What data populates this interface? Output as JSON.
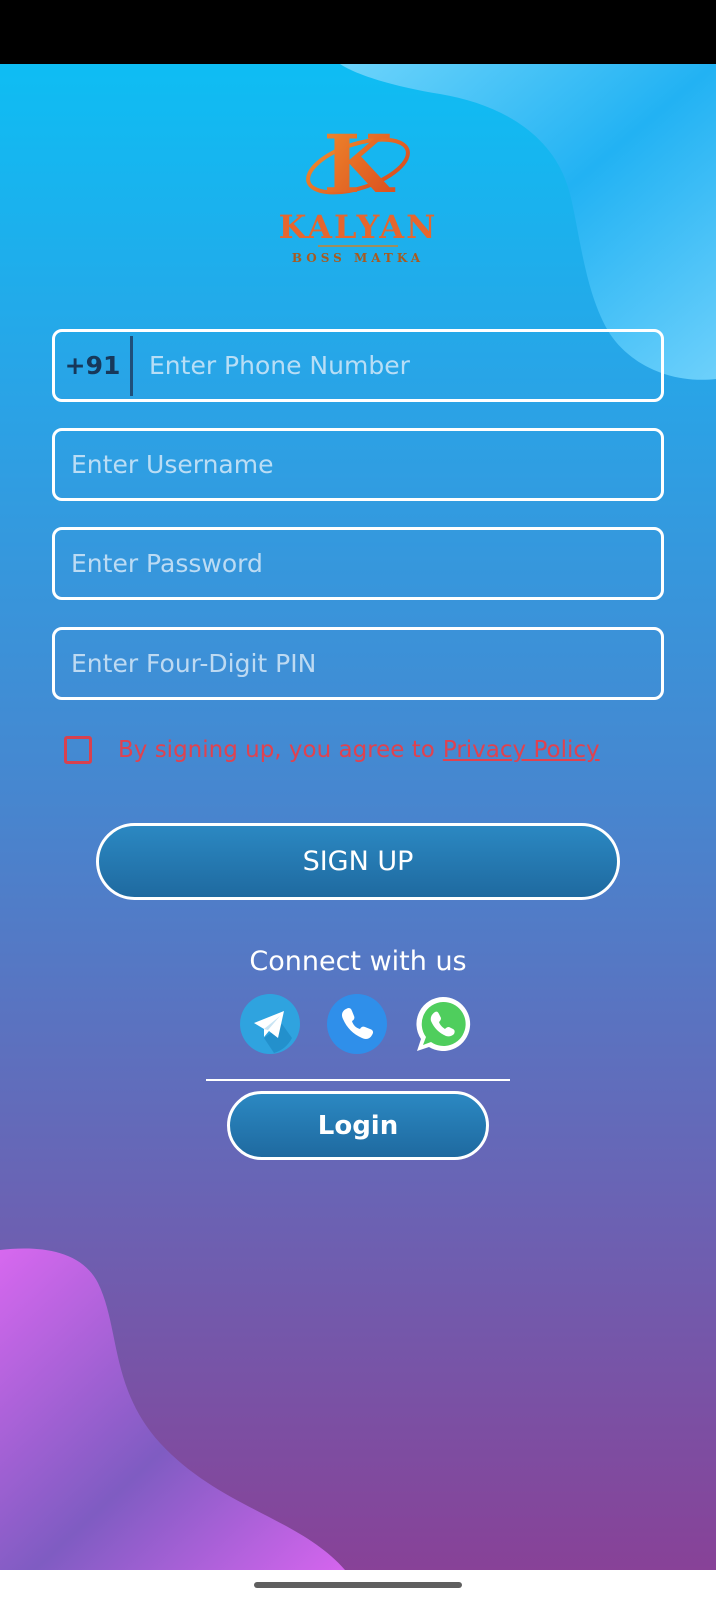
{
  "brand": {
    "logo_letter": "K",
    "name": "KALYAN",
    "tagline": "BOSS MATKA"
  },
  "form": {
    "phone": {
      "prefix": "+91",
      "placeholder": "Enter Phone Number",
      "value": ""
    },
    "username": {
      "placeholder": "Enter Username",
      "value": ""
    },
    "password": {
      "placeholder": "Enter Password",
      "value": ""
    },
    "pin": {
      "placeholder": "Enter Four-Digit PIN",
      "value": ""
    }
  },
  "agreement": {
    "checked": false,
    "text": "By signing up, you agree to",
    "link": "Privacy Policy"
  },
  "buttons": {
    "signup": "SIGN UP",
    "login": "Login"
  },
  "connect": {
    "title": "Connect with us",
    "icons": [
      "telegram-icon",
      "phone-icon",
      "whatsapp-icon"
    ]
  },
  "colors": {
    "gradient_top": "#09c2f6",
    "gradient_bottom": "#8a3f95",
    "accent_red": "#e0424f",
    "button_blue": "#2b88c2",
    "telegram": "#2fa3df",
    "phone": "#2f8fea",
    "whatsapp": "#4fce5d"
  }
}
